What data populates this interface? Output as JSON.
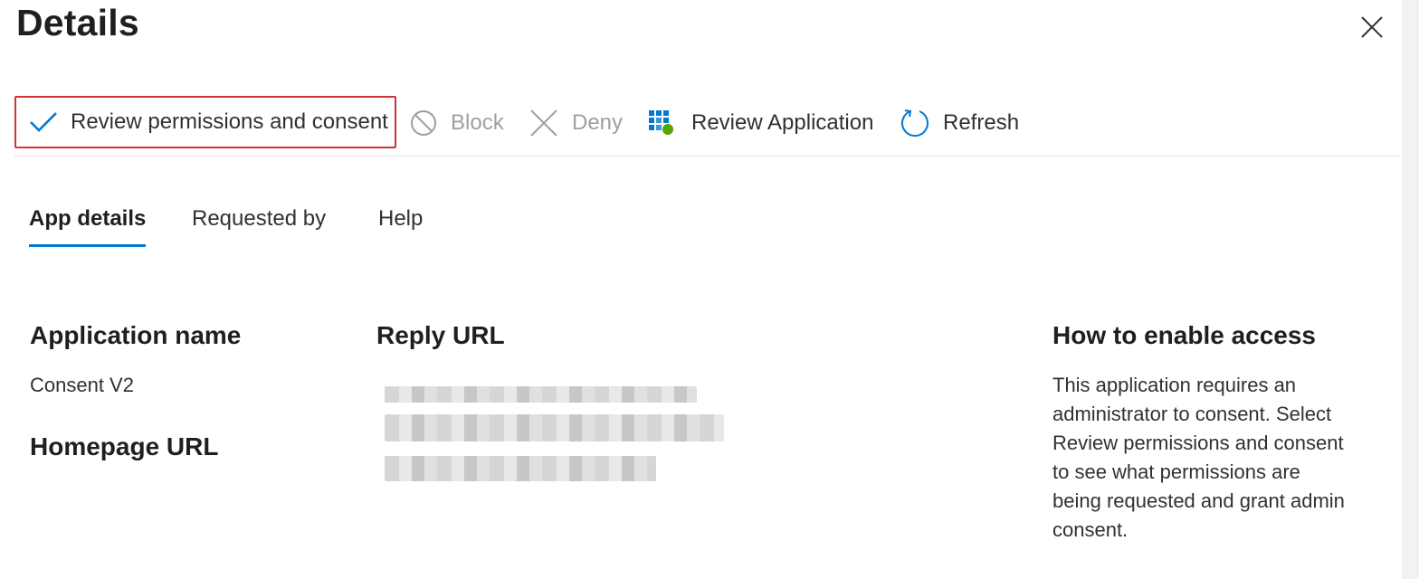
{
  "header": {
    "title": "Details",
    "close_icon": "close-icon"
  },
  "toolbar": {
    "review_permissions_label": "Review permissions and consent",
    "block_label": "Block",
    "deny_label": "Deny",
    "review_application_label": "Review Application",
    "refresh_label": "Refresh",
    "accent_color": "#0078d4",
    "highlight_border_color": "#d13438",
    "icons": [
      "checkmark-icon",
      "block-icon",
      "deny-icon",
      "review-application-icon",
      "refresh-icon"
    ]
  },
  "tabs": [
    {
      "label": "App details",
      "active": true
    },
    {
      "label": "Requested by",
      "active": false
    },
    {
      "label": "Help",
      "active": false
    }
  ],
  "app_details": {
    "application_name_heading": "Application name",
    "application_name_value": "Consent V2",
    "homepage_url_heading": "Homepage URL",
    "reply_url_heading": "Reply URL"
  },
  "help_panel": {
    "heading": "How to enable access",
    "lines": [
      "This application requires an",
      "administrator to consent. Select",
      "Review permissions and consent",
      "to see what permissions are",
      "being requested and grant admin",
      "consent."
    ]
  }
}
